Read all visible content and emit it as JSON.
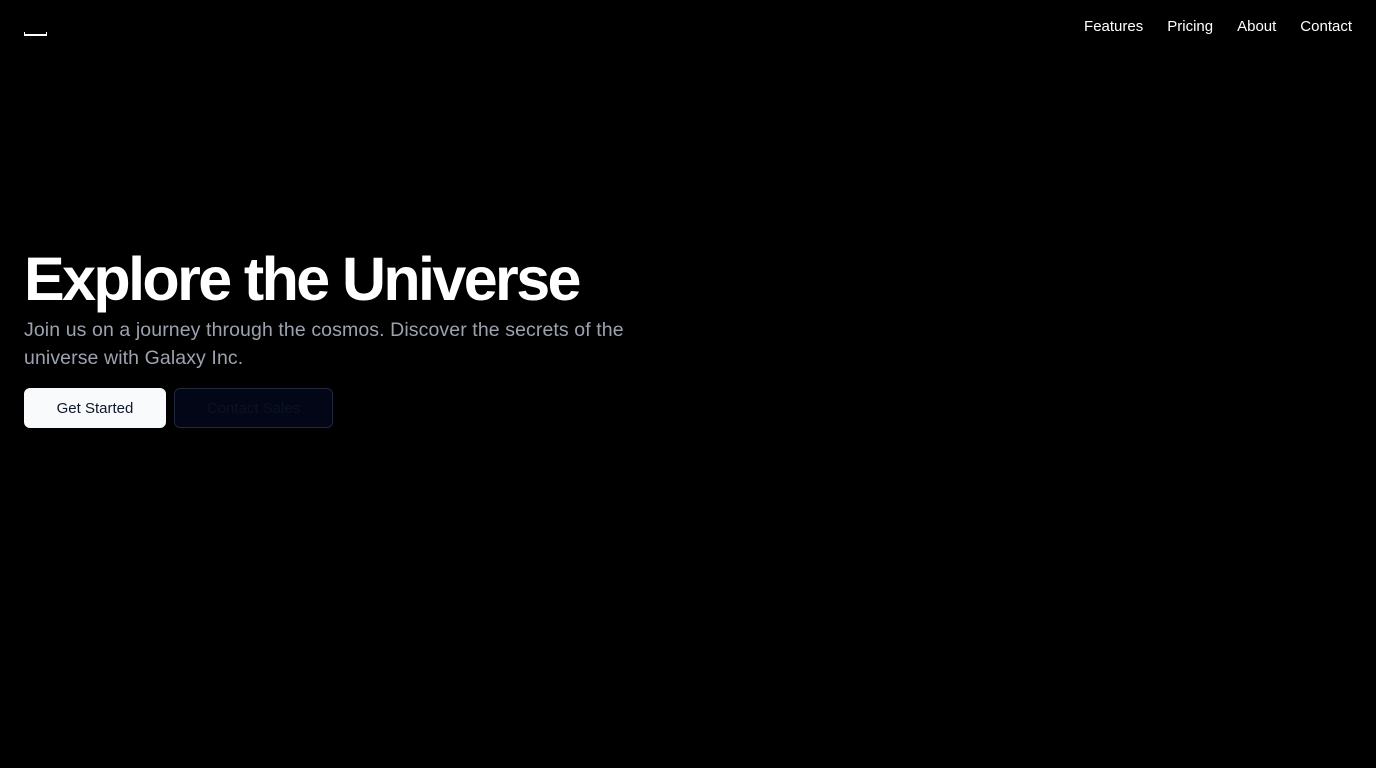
{
  "header": {
    "logo_icon": "bracket-logo-icon",
    "nav": {
      "items": [
        {
          "label": "Features"
        },
        {
          "label": "Pricing"
        },
        {
          "label": "About"
        },
        {
          "label": "Contact"
        }
      ]
    }
  },
  "hero": {
    "title": "Explore the Universe",
    "subtitle": "Join us on a journey through the cosmos. Discover the secrets of the universe with Galaxy Inc.",
    "primary_button": "Get Started",
    "secondary_button": "Contact Sales"
  },
  "colors": {
    "background": "#000000",
    "text": "#ffffff",
    "muted_text": "#9ca3af",
    "primary_button_bg": "#f8fafc",
    "primary_button_text": "#0f172a",
    "secondary_button_bg": "#020617",
    "secondary_button_border": "#1e293b"
  }
}
